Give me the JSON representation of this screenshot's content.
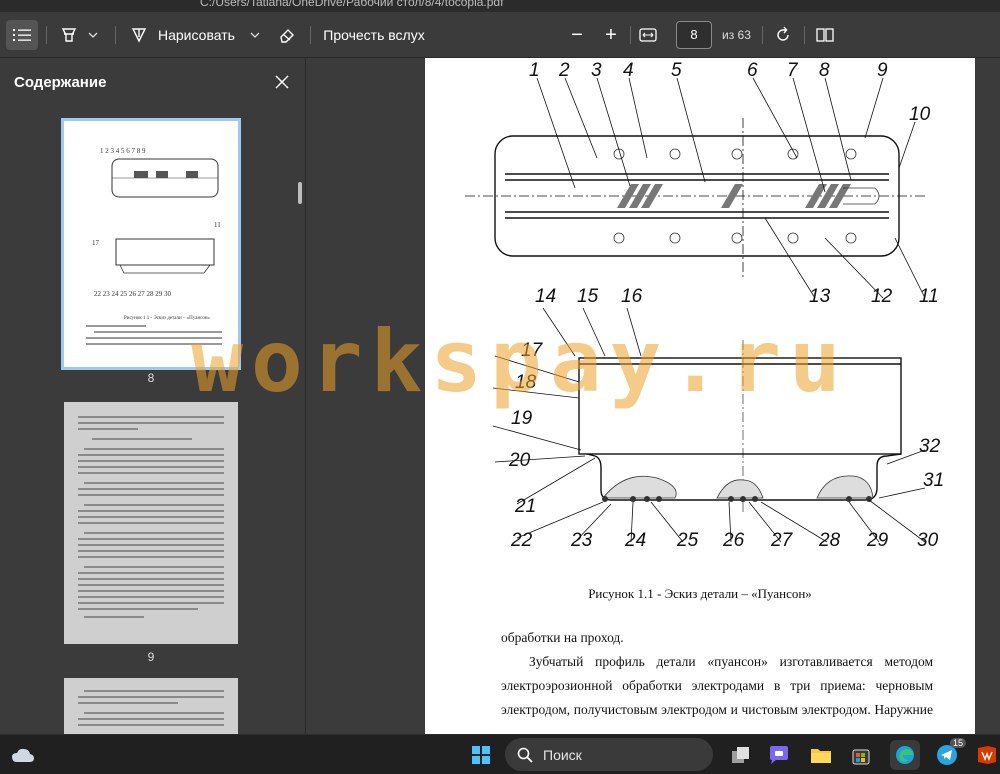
{
  "window": {
    "path_text": "C:/Users/Tatiana/OneDrive/Рабочий стол/8/4/tocopia.pdf"
  },
  "toolbar": {
    "contents_icon": "list-icon",
    "highlight_icon": "highlighter-icon",
    "draw_label": "Нарисовать",
    "erase_icon": "eraser-icon",
    "read_aloud_label": "Прочесть вслух",
    "zoom_out": "−",
    "zoom_in": "+",
    "page_value": "8",
    "page_total": "из 63"
  },
  "sidebar": {
    "title": "Содержание",
    "thumbnails": [
      {
        "label": "8",
        "selected": true
      },
      {
        "label": "9",
        "selected": false
      },
      {
        "label": "",
        "selected": false
      }
    ]
  },
  "document": {
    "drawing": {
      "top_numbers": [
        "1",
        "2",
        "3",
        "4",
        "5",
        "6",
        "7",
        "8",
        "9",
        "10"
      ],
      "right_numbers_top": [
        "13",
        "12",
        "11"
      ],
      "side_numbers": [
        "14",
        "15",
        "16",
        "17",
        "18",
        "19",
        "20",
        "21",
        "22"
      ],
      "bottom_numbers": [
        "23",
        "24",
        "25",
        "26",
        "27",
        "28",
        "29",
        "30"
      ],
      "right_numbers_bottom": [
        "32",
        "31"
      ]
    },
    "caption": "Рисунок 1.1 - Эскиз детали – «Пуансон»",
    "paragraph_lines": [
      "обработки на проход.",
      "Зубчатый профиль детали «пуансон» изготавливается методом",
      "электроэрозионной обработки электродами в три приема: черновым",
      "электродом, получистовым электродом и чистовым электродом. Наружние"
    ]
  },
  "watermark": "workspay.ru",
  "taskbar": {
    "search_placeholder": "Поиск",
    "telegram_badge": "15"
  }
}
